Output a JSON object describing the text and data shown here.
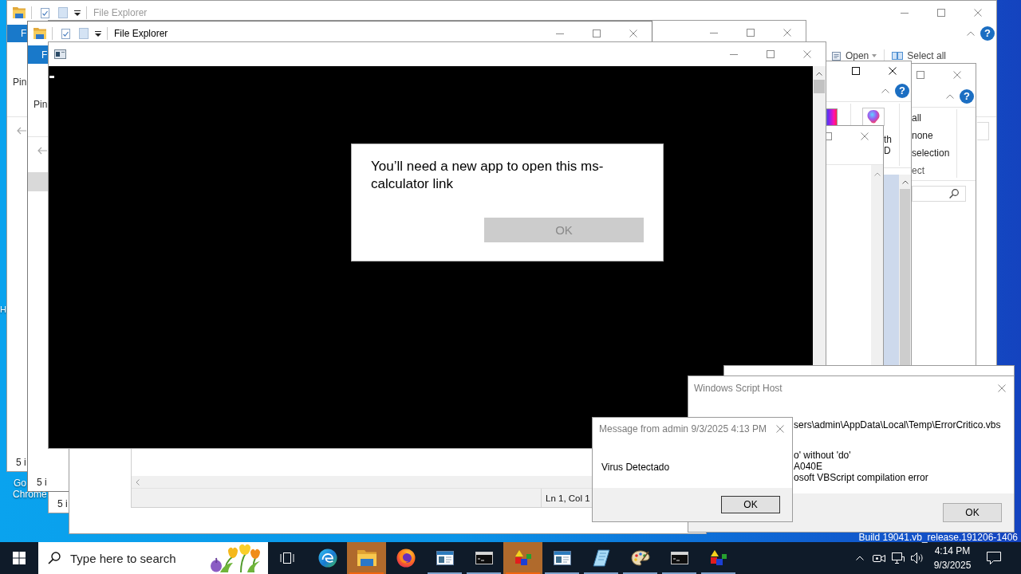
{
  "desktop": {
    "side_label": "H",
    "shortcut_label_lines": [
      "Go",
      "Chrome"
    ],
    "build_info": "Build 19041.vb_release.191206-1406"
  },
  "explorer_back": {
    "title": "File Explorer",
    "active": false,
    "file_tab": "F",
    "ribbon_label": "Pin",
    "open_button": "Open",
    "select_all_button": "Select all",
    "help": "?",
    "status": "5 i"
  },
  "explorer_middle": {
    "status": "5 i"
  },
  "explorer_front": {
    "title": "File Explorer",
    "active": true,
    "file_tab": "F",
    "ribbon_label": "Pin",
    "nav_items": [
      {
        "selected": true
      }
    ],
    "status": "5 i"
  },
  "editor": {
    "status": "Ln 1, Col 1"
  },
  "select_window": {
    "help": "?",
    "select_items": [
      "all",
      "none",
      "selection"
    ],
    "group_label": "ect"
  },
  "image_window": {
    "help": "?",
    "command_label_lines": [
      "th",
      "D"
    ],
    "list_items": [
      {
        "selected": true
      }
    ]
  },
  "app_prompt": {
    "message": "You’ll need a new app to open this ms-calculator link",
    "button": {
      "label": "OK",
      "disabled": true
    }
  },
  "script_host": {
    "title": "Windows Script Host",
    "active": false,
    "lines": [
      "sers\\admin\\AppData\\Local\\Temp\\ErrorCritico.vbs",
      "o' without 'do'",
      "A040E",
      "osoft VBScript compilation error"
    ],
    "button": "OK"
  },
  "message_box": {
    "title": "Message from admin 9/3/2025 4:13 PM",
    "active": false,
    "text": "Virus Detectado",
    "button": "OK"
  },
  "taskbar": {
    "search": {
      "placeholder": "Type here to search"
    },
    "apps": [
      {
        "kind": "swirl",
        "flashing": false,
        "running": false
      },
      {
        "kind": "folder",
        "flashing": true,
        "running": true
      },
      {
        "kind": "globe",
        "flashing": false,
        "running": false
      },
      {
        "kind": "window",
        "flashing": false,
        "running": true
      },
      {
        "kind": "terminal",
        "flashing": false,
        "running": true
      },
      {
        "kind": "shapes",
        "flashing": true,
        "running": true
      },
      {
        "kind": "window",
        "flashing": false,
        "running": true
      },
      {
        "kind": "pad",
        "flashing": false,
        "running": true
      },
      {
        "kind": "palette",
        "flashing": false,
        "running": true
      },
      {
        "kind": "terminal",
        "flashing": false,
        "running": true
      },
      {
        "kind": "shapes",
        "flashing": false,
        "running": true
      }
    ],
    "clock": {
      "time": "4:14 PM",
      "date": "9/3/2025"
    }
  }
}
